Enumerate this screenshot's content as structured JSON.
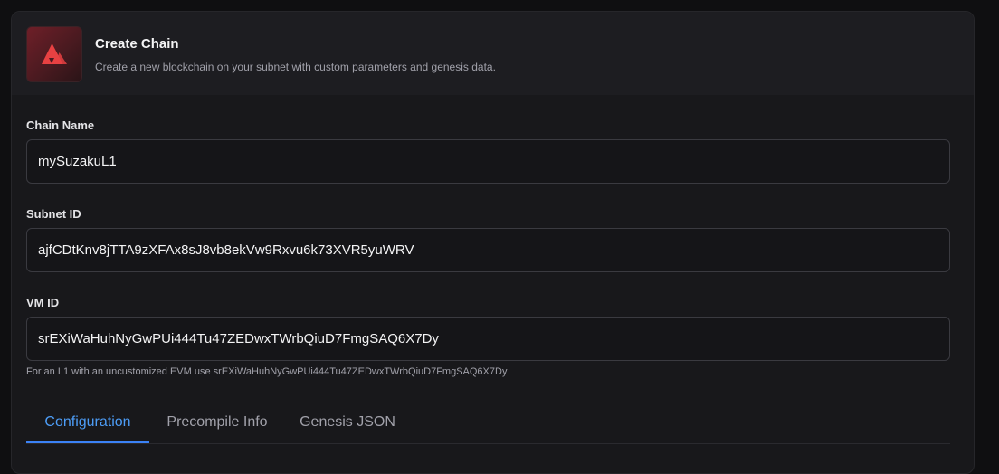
{
  "header": {
    "title": "Create Chain",
    "description": "Create a new blockchain on your subnet with custom parameters and genesis data."
  },
  "fields": {
    "chain_name": {
      "label": "Chain Name",
      "value": "mySuzakuL1"
    },
    "subnet_id": {
      "label": "Subnet ID",
      "value": "ajfCDtKnv8jTTA9zXFAx8sJ8vb8ekVw9Rxvu6k73XVR5yuWRV"
    },
    "vm_id": {
      "label": "VM ID",
      "value": "srEXiWaHuhNyGwPUi444Tu47ZEDwxTWrbQiuD7FmgSAQ6X7Dy",
      "hint": "For an L1 with an uncustomized EVM use srEXiWaHuhNyGwPUi444Tu47ZEDwxTWrbQiuD7FmgSAQ6X7Dy"
    }
  },
  "tabs": [
    {
      "label": "Configuration",
      "active": true
    },
    {
      "label": "Precompile Info",
      "active": false
    },
    {
      "label": "Genesis JSON",
      "active": false
    }
  ],
  "colors": {
    "accent": "#3b82f6",
    "logo": "#e84142"
  },
  "icons": {
    "logo": "avalanche-logo-icon"
  }
}
